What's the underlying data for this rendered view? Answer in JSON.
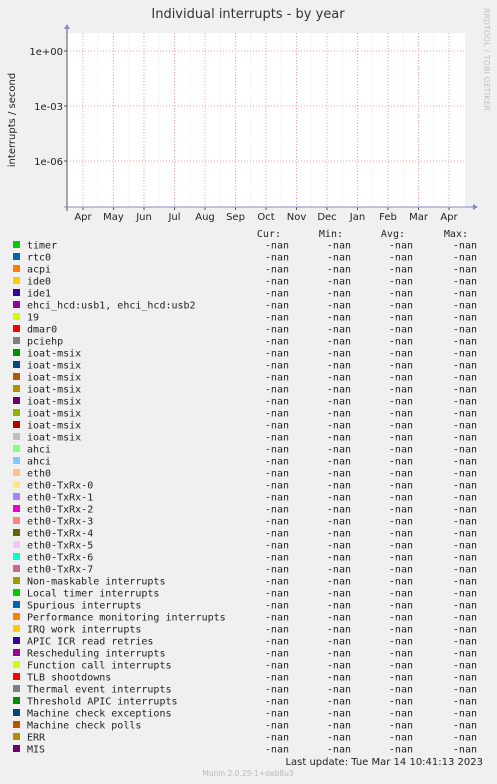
{
  "chart_data": {
    "type": "line",
    "title": "Individual interrupts - by year",
    "ylabel": "interrupts / second",
    "yscale": "log",
    "yticks": [
      "1e+00",
      "1e-03",
      "1e-06"
    ],
    "x_tick_labels": [
      "Apr",
      "May",
      "Jun",
      "Jul",
      "Aug",
      "Sep",
      "Oct",
      "Nov",
      "Dec",
      "Jan",
      "Feb",
      "Mar",
      "Apr"
    ],
    "grid": true,
    "legend_columns": [
      "Cur:",
      "Min:",
      "Avg:",
      "Max:"
    ],
    "series": [
      {
        "name": "timer",
        "color": "#00cc00",
        "cur": "-nan",
        "min": "-nan",
        "avg": "-nan",
        "max": "-nan"
      },
      {
        "name": "rtc0",
        "color": "#0066b3",
        "cur": "-nan",
        "min": "-nan",
        "avg": "-nan",
        "max": "-nan"
      },
      {
        "name": "acpi",
        "color": "#ff8000",
        "cur": "-nan",
        "min": "-nan",
        "avg": "-nan",
        "max": "-nan"
      },
      {
        "name": "ide0",
        "color": "#ffcc00",
        "cur": "-nan",
        "min": "-nan",
        "avg": "-nan",
        "max": "-nan"
      },
      {
        "name": "ide1",
        "color": "#330099",
        "cur": "-nan",
        "min": "-nan",
        "avg": "-nan",
        "max": "-nan"
      },
      {
        "name": "ehci_hcd:usb1, ehci_hcd:usb2",
        "color": "#990099",
        "cur": "-nan",
        "min": "-nan",
        "avg": "-nan",
        "max": "-nan"
      },
      {
        "name": "19",
        "color": "#ccff00",
        "cur": "-nan",
        "min": "-nan",
        "avg": "-nan",
        "max": "-nan"
      },
      {
        "name": "dmar0",
        "color": "#ff0000",
        "cur": "-nan",
        "min": "-nan",
        "avg": "-nan",
        "max": "-nan"
      },
      {
        "name": "pciehp",
        "color": "#808080",
        "cur": "-nan",
        "min": "-nan",
        "avg": "-nan",
        "max": "-nan"
      },
      {
        "name": "ioat-msix",
        "color": "#008f00",
        "cur": "-nan",
        "min": "-nan",
        "avg": "-nan",
        "max": "-nan"
      },
      {
        "name": "ioat-msix",
        "color": "#00487d",
        "cur": "-nan",
        "min": "-nan",
        "avg": "-nan",
        "max": "-nan"
      },
      {
        "name": "ioat-msix",
        "color": "#b35a00",
        "cur": "-nan",
        "min": "-nan",
        "avg": "-nan",
        "max": "-nan"
      },
      {
        "name": "ioat-msix",
        "color": "#b38f00",
        "cur": "-nan",
        "min": "-nan",
        "avg": "-nan",
        "max": "-nan"
      },
      {
        "name": "ioat-msix",
        "color": "#6b006b",
        "cur": "-nan",
        "min": "-nan",
        "avg": "-nan",
        "max": "-nan"
      },
      {
        "name": "ioat-msix",
        "color": "#8fb300",
        "cur": "-nan",
        "min": "-nan",
        "avg": "-nan",
        "max": "-nan"
      },
      {
        "name": "ioat-msix",
        "color": "#b30000",
        "cur": "-nan",
        "min": "-nan",
        "avg": "-nan",
        "max": "-nan"
      },
      {
        "name": "ioat-msix",
        "color": "#bebebe",
        "cur": "-nan",
        "min": "-nan",
        "avg": "-nan",
        "max": "-nan"
      },
      {
        "name": "ahci",
        "color": "#80ff80",
        "cur": "-nan",
        "min": "-nan",
        "avg": "-nan",
        "max": "-nan"
      },
      {
        "name": "ahci",
        "color": "#80c9ff",
        "cur": "-nan",
        "min": "-nan",
        "avg": "-nan",
        "max": "-nan"
      },
      {
        "name": "eth0",
        "color": "#ffc080",
        "cur": "-nan",
        "min": "-nan",
        "avg": "-nan",
        "max": "-nan"
      },
      {
        "name": "eth0-TxRx-0",
        "color": "#ffe680",
        "cur": "-nan",
        "min": "-nan",
        "avg": "-nan",
        "max": "-nan"
      },
      {
        "name": "eth0-TxRx-1",
        "color": "#aa80ff",
        "cur": "-nan",
        "min": "-nan",
        "avg": "-nan",
        "max": "-nan"
      },
      {
        "name": "eth0-TxRx-2",
        "color": "#ee00cc",
        "cur": "-nan",
        "min": "-nan",
        "avg": "-nan",
        "max": "-nan"
      },
      {
        "name": "eth0-TxRx-3",
        "color": "#ff8080",
        "cur": "-nan",
        "min": "-nan",
        "avg": "-nan",
        "max": "-nan"
      },
      {
        "name": "eth0-TxRx-4",
        "color": "#666600",
        "cur": "-nan",
        "min": "-nan",
        "avg": "-nan",
        "max": "-nan"
      },
      {
        "name": "eth0-TxRx-5",
        "color": "#ffbfff",
        "cur": "-nan",
        "min": "-nan",
        "avg": "-nan",
        "max": "-nan"
      },
      {
        "name": "eth0-TxRx-6",
        "color": "#00ffcc",
        "cur": "-nan",
        "min": "-nan",
        "avg": "-nan",
        "max": "-nan"
      },
      {
        "name": "eth0-TxRx-7",
        "color": "#cc6699",
        "cur": "-nan",
        "min": "-nan",
        "avg": "-nan",
        "max": "-nan"
      },
      {
        "name": "Non-maskable interrupts",
        "color": "#999900",
        "cur": "-nan",
        "min": "-nan",
        "avg": "-nan",
        "max": "-nan"
      },
      {
        "name": "Local timer interrupts",
        "color": "#00cc00",
        "cur": "-nan",
        "min": "-nan",
        "avg": "-nan",
        "max": "-nan"
      },
      {
        "name": "Spurious interrupts",
        "color": "#0066b3",
        "cur": "-nan",
        "min": "-nan",
        "avg": "-nan",
        "max": "-nan"
      },
      {
        "name": "Performance monitoring interrupts",
        "color": "#ff8000",
        "cur": "-nan",
        "min": "-nan",
        "avg": "-nan",
        "max": "-nan"
      },
      {
        "name": "IRQ work interrupts",
        "color": "#ffcc00",
        "cur": "-nan",
        "min": "-nan",
        "avg": "-nan",
        "max": "-nan"
      },
      {
        "name": "APIC ICR read retries",
        "color": "#330099",
        "cur": "-nan",
        "min": "-nan",
        "avg": "-nan",
        "max": "-nan"
      },
      {
        "name": "Rescheduling interrupts",
        "color": "#990099",
        "cur": "-nan",
        "min": "-nan",
        "avg": "-nan",
        "max": "-nan"
      },
      {
        "name": "Function call interrupts",
        "color": "#ccff00",
        "cur": "-nan",
        "min": "-nan",
        "avg": "-nan",
        "max": "-nan"
      },
      {
        "name": "TLB shootdowns",
        "color": "#ff0000",
        "cur": "-nan",
        "min": "-nan",
        "avg": "-nan",
        "max": "-nan"
      },
      {
        "name": "Thermal event interrupts",
        "color": "#808080",
        "cur": "-nan",
        "min": "-nan",
        "avg": "-nan",
        "max": "-nan"
      },
      {
        "name": "Threshold APIC interrupts",
        "color": "#008f00",
        "cur": "-nan",
        "min": "-nan",
        "avg": "-nan",
        "max": "-nan"
      },
      {
        "name": "Machine check exceptions",
        "color": "#00487d",
        "cur": "-nan",
        "min": "-nan",
        "avg": "-nan",
        "max": "-nan"
      },
      {
        "name": "Machine check polls",
        "color": "#b35a00",
        "cur": "-nan",
        "min": "-nan",
        "avg": "-nan",
        "max": "-nan"
      },
      {
        "name": "ERR",
        "color": "#b38f00",
        "cur": "-nan",
        "min": "-nan",
        "avg": "-nan",
        "max": "-nan"
      },
      {
        "name": "MIS",
        "color": "#6b006b",
        "cur": "-nan",
        "min": "-nan",
        "avg": "-nan",
        "max": "-nan"
      }
    ]
  },
  "watermark": "RRDTOOL / TOBI OETIKER",
  "footer": {
    "last_update": "Last update:  Tue Mar 14 10:41:13 2023",
    "munin_version": "Munin 2.0.25-1+deb8u3"
  },
  "colors": {
    "background": "#f0f0f0",
    "plot_background": "#ffffff",
    "grid": "#ff9999",
    "axis": "#8888cc"
  }
}
